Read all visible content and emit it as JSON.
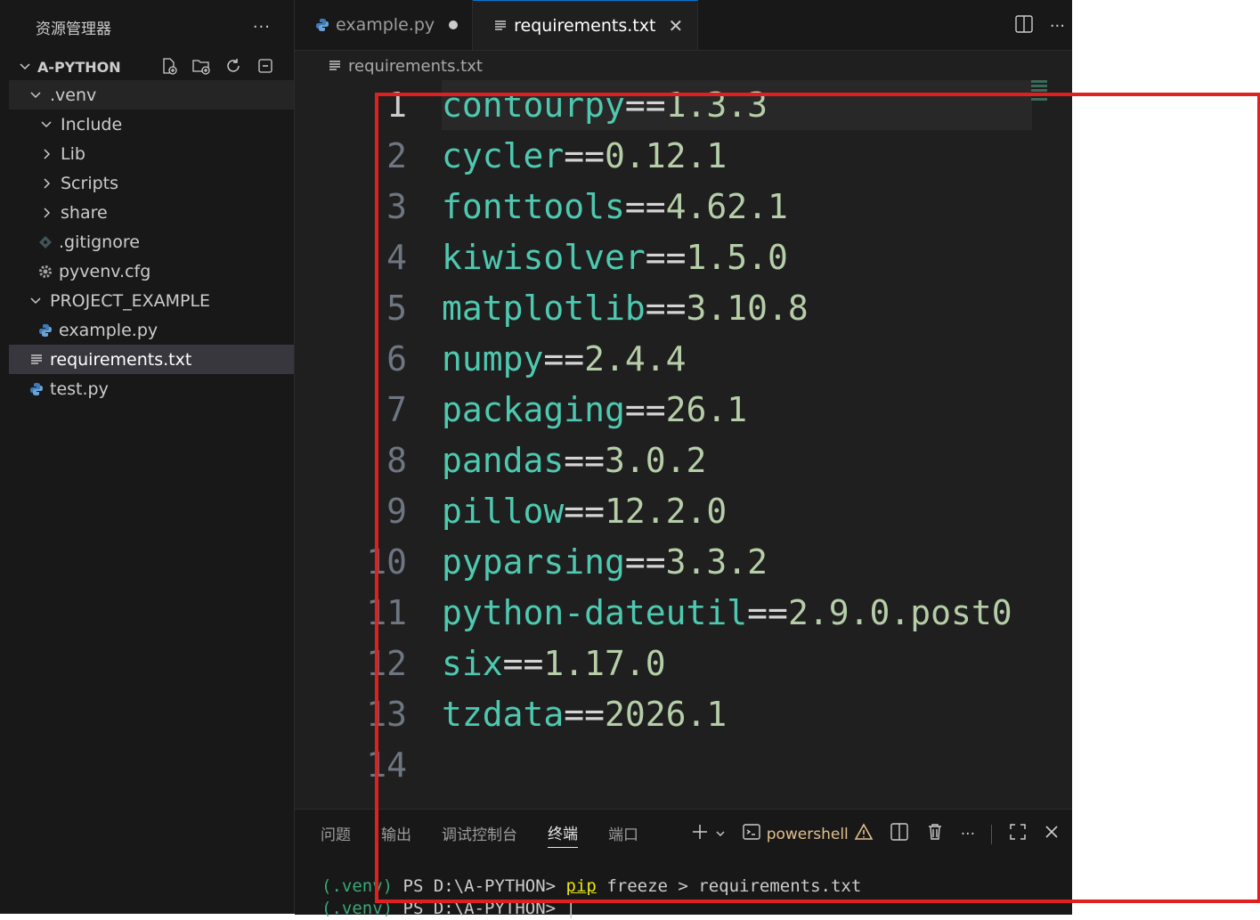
{
  "sidebar": {
    "title": "资源管理器",
    "more": "···",
    "root": {
      "label": "A-PYTHON"
    },
    "items": [
      {
        "label": ".venv"
      },
      {
        "label": "Include"
      },
      {
        "label": "Lib"
      },
      {
        "label": "Scripts"
      },
      {
        "label": "share"
      },
      {
        "label": ".gitignore"
      },
      {
        "label": "pyvenv.cfg"
      },
      {
        "label": "PROJECT_EXAMPLE"
      },
      {
        "label": "example.py"
      },
      {
        "label": "requirements.txt"
      },
      {
        "label": "test.py"
      }
    ]
  },
  "tabs": [
    {
      "label": "example.py"
    },
    {
      "label": "requirements.txt"
    }
  ],
  "breadcrumb": "requirements.txt",
  "editor": {
    "lines": [
      {
        "num": "1",
        "pkg": "contourpy",
        "op": "==",
        "ver": "1.3.3"
      },
      {
        "num": "2",
        "pkg": "cycler",
        "op": "==",
        "ver": "0.12.1"
      },
      {
        "num": "3",
        "pkg": "fonttools",
        "op": "==",
        "ver": "4.62.1"
      },
      {
        "num": "4",
        "pkg": "kiwisolver",
        "op": "==",
        "ver": "1.5.0"
      },
      {
        "num": "5",
        "pkg": "matplotlib",
        "op": "==",
        "ver": "3.10.8"
      },
      {
        "num": "6",
        "pkg": "numpy",
        "op": "==",
        "ver": "2.4.4"
      },
      {
        "num": "7",
        "pkg": "packaging",
        "op": "==",
        "ver": "26.1"
      },
      {
        "num": "8",
        "pkg": "pandas",
        "op": "==",
        "ver": "3.0.2"
      },
      {
        "num": "9",
        "pkg": "pillow",
        "op": "==",
        "ver": "12.2.0"
      },
      {
        "num": "10",
        "pkg": "pyparsing",
        "op": "==",
        "ver": "3.3.2"
      },
      {
        "num": "11",
        "pkg": "python-dateutil",
        "op": "==",
        "ver": "2.9.0.post0"
      },
      {
        "num": "12",
        "pkg": "six",
        "op": "==",
        "ver": "1.17.0"
      },
      {
        "num": "13",
        "pkg": "tzdata",
        "op": "==",
        "ver": "2026.1"
      },
      {
        "num": "14",
        "pkg": "",
        "op": "",
        "ver": ""
      }
    ]
  },
  "panel": {
    "tabs": [
      "问题",
      "输出",
      "调试控制台",
      "终端",
      "端口"
    ],
    "shell": "powershell",
    "terminal": {
      "line1": {
        "venv": "(.venv)",
        "prompt": " PS D:\\A-PYTHON> ",
        "cmd": "pip",
        "args": " freeze > requirements.txt"
      },
      "line2": {
        "venv": "(.venv)",
        "prompt": " PS D:\\A-PYTHON> ",
        "cursor": "|"
      }
    }
  },
  "colors": {
    "package": "#4ec9b0",
    "version": "#b5cea8",
    "annotation_box": "#e02020",
    "accent": "#0078d4"
  }
}
